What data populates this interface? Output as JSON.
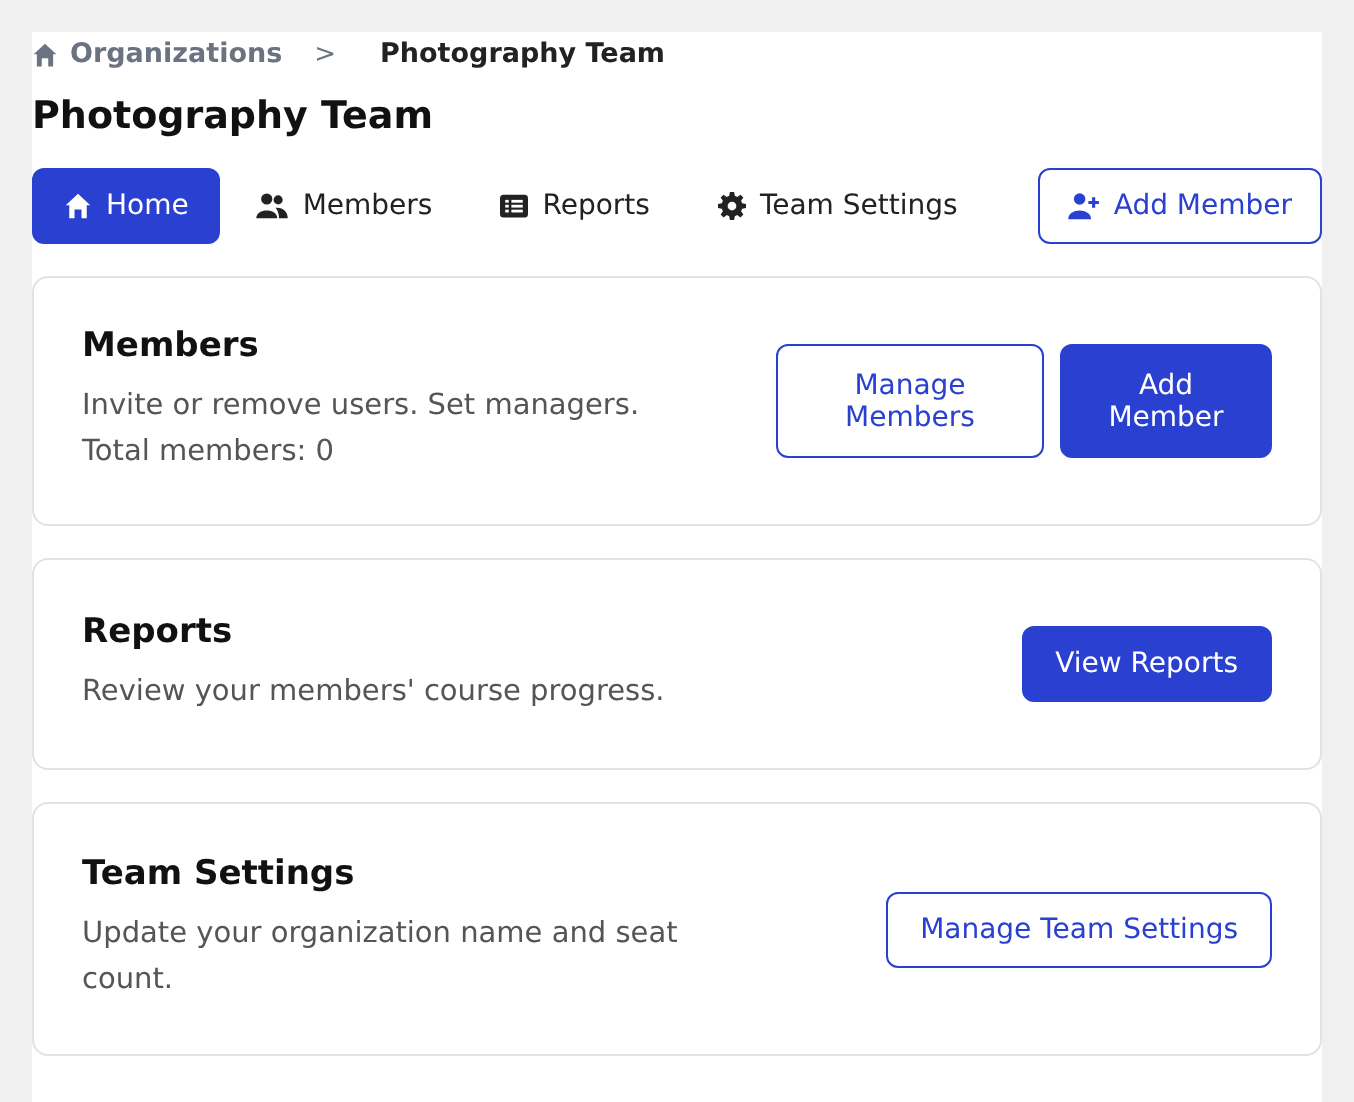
{
  "breadcrumb": {
    "items": [
      {
        "label": "Organizations",
        "current": false
      },
      {
        "label": "Photography Team",
        "current": true
      }
    ],
    "separator": ">"
  },
  "title": "Photography Team",
  "tabs": [
    {
      "label": "Home",
      "selected": true
    },
    {
      "label": "Members",
      "selected": false
    },
    {
      "label": "Reports",
      "selected": false
    },
    {
      "label": "Team Settings",
      "selected": false
    }
  ],
  "header_button": "Add Member",
  "cards": [
    {
      "title": "Members",
      "lines": [
        "Invite or remove users. Set managers.",
        "Total members: 0"
      ],
      "buttons": [
        {
          "label": "Manage Members",
          "kind": "outline"
        },
        {
          "label": "Add Member",
          "kind": "primary"
        }
      ]
    },
    {
      "title": "Reports",
      "lines": [
        "Review your members' course progress."
      ],
      "buttons": [
        {
          "label": "View Reports",
          "kind": "primary"
        }
      ]
    },
    {
      "title": "Team Settings",
      "lines": [
        "Update your organization name and seat count."
      ],
      "buttons": [
        {
          "label": "Manage Team Settings",
          "kind": "outline"
        }
      ]
    }
  ]
}
